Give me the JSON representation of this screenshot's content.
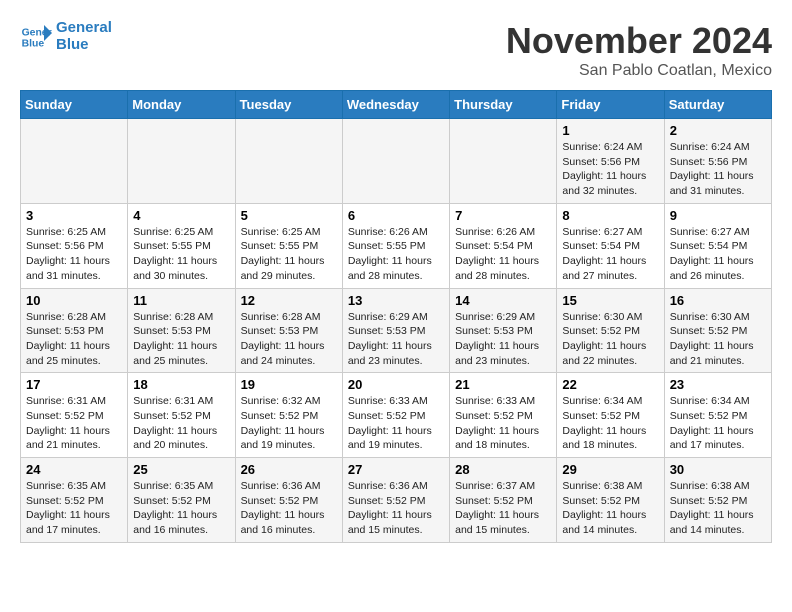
{
  "header": {
    "logo_line1": "General",
    "logo_line2": "Blue",
    "month": "November 2024",
    "location": "San Pablo Coatlan, Mexico"
  },
  "weekdays": [
    "Sunday",
    "Monday",
    "Tuesday",
    "Wednesday",
    "Thursday",
    "Friday",
    "Saturday"
  ],
  "weeks": [
    [
      {
        "day": "",
        "info": ""
      },
      {
        "day": "",
        "info": ""
      },
      {
        "day": "",
        "info": ""
      },
      {
        "day": "",
        "info": ""
      },
      {
        "day": "",
        "info": ""
      },
      {
        "day": "1",
        "info": "Sunrise: 6:24 AM\nSunset: 5:56 PM\nDaylight: 11 hours\nand 32 minutes."
      },
      {
        "day": "2",
        "info": "Sunrise: 6:24 AM\nSunset: 5:56 PM\nDaylight: 11 hours\nand 31 minutes."
      }
    ],
    [
      {
        "day": "3",
        "info": "Sunrise: 6:25 AM\nSunset: 5:56 PM\nDaylight: 11 hours\nand 31 minutes."
      },
      {
        "day": "4",
        "info": "Sunrise: 6:25 AM\nSunset: 5:55 PM\nDaylight: 11 hours\nand 30 minutes."
      },
      {
        "day": "5",
        "info": "Sunrise: 6:25 AM\nSunset: 5:55 PM\nDaylight: 11 hours\nand 29 minutes."
      },
      {
        "day": "6",
        "info": "Sunrise: 6:26 AM\nSunset: 5:55 PM\nDaylight: 11 hours\nand 28 minutes."
      },
      {
        "day": "7",
        "info": "Sunrise: 6:26 AM\nSunset: 5:54 PM\nDaylight: 11 hours\nand 28 minutes."
      },
      {
        "day": "8",
        "info": "Sunrise: 6:27 AM\nSunset: 5:54 PM\nDaylight: 11 hours\nand 27 minutes."
      },
      {
        "day": "9",
        "info": "Sunrise: 6:27 AM\nSunset: 5:54 PM\nDaylight: 11 hours\nand 26 minutes."
      }
    ],
    [
      {
        "day": "10",
        "info": "Sunrise: 6:28 AM\nSunset: 5:53 PM\nDaylight: 11 hours\nand 25 minutes."
      },
      {
        "day": "11",
        "info": "Sunrise: 6:28 AM\nSunset: 5:53 PM\nDaylight: 11 hours\nand 25 minutes."
      },
      {
        "day": "12",
        "info": "Sunrise: 6:28 AM\nSunset: 5:53 PM\nDaylight: 11 hours\nand 24 minutes."
      },
      {
        "day": "13",
        "info": "Sunrise: 6:29 AM\nSunset: 5:53 PM\nDaylight: 11 hours\nand 23 minutes."
      },
      {
        "day": "14",
        "info": "Sunrise: 6:29 AM\nSunset: 5:53 PM\nDaylight: 11 hours\nand 23 minutes."
      },
      {
        "day": "15",
        "info": "Sunrise: 6:30 AM\nSunset: 5:52 PM\nDaylight: 11 hours\nand 22 minutes."
      },
      {
        "day": "16",
        "info": "Sunrise: 6:30 AM\nSunset: 5:52 PM\nDaylight: 11 hours\nand 21 minutes."
      }
    ],
    [
      {
        "day": "17",
        "info": "Sunrise: 6:31 AM\nSunset: 5:52 PM\nDaylight: 11 hours\nand 21 minutes."
      },
      {
        "day": "18",
        "info": "Sunrise: 6:31 AM\nSunset: 5:52 PM\nDaylight: 11 hours\nand 20 minutes."
      },
      {
        "day": "19",
        "info": "Sunrise: 6:32 AM\nSunset: 5:52 PM\nDaylight: 11 hours\nand 19 minutes."
      },
      {
        "day": "20",
        "info": "Sunrise: 6:33 AM\nSunset: 5:52 PM\nDaylight: 11 hours\nand 19 minutes."
      },
      {
        "day": "21",
        "info": "Sunrise: 6:33 AM\nSunset: 5:52 PM\nDaylight: 11 hours\nand 18 minutes."
      },
      {
        "day": "22",
        "info": "Sunrise: 6:34 AM\nSunset: 5:52 PM\nDaylight: 11 hours\nand 18 minutes."
      },
      {
        "day": "23",
        "info": "Sunrise: 6:34 AM\nSunset: 5:52 PM\nDaylight: 11 hours\nand 17 minutes."
      }
    ],
    [
      {
        "day": "24",
        "info": "Sunrise: 6:35 AM\nSunset: 5:52 PM\nDaylight: 11 hours\nand 17 minutes."
      },
      {
        "day": "25",
        "info": "Sunrise: 6:35 AM\nSunset: 5:52 PM\nDaylight: 11 hours\nand 16 minutes."
      },
      {
        "day": "26",
        "info": "Sunrise: 6:36 AM\nSunset: 5:52 PM\nDaylight: 11 hours\nand 16 minutes."
      },
      {
        "day": "27",
        "info": "Sunrise: 6:36 AM\nSunset: 5:52 PM\nDaylight: 11 hours\nand 15 minutes."
      },
      {
        "day": "28",
        "info": "Sunrise: 6:37 AM\nSunset: 5:52 PM\nDaylight: 11 hours\nand 15 minutes."
      },
      {
        "day": "29",
        "info": "Sunrise: 6:38 AM\nSunset: 5:52 PM\nDaylight: 11 hours\nand 14 minutes."
      },
      {
        "day": "30",
        "info": "Sunrise: 6:38 AM\nSunset: 5:52 PM\nDaylight: 11 hours\nand 14 minutes."
      }
    ]
  ]
}
